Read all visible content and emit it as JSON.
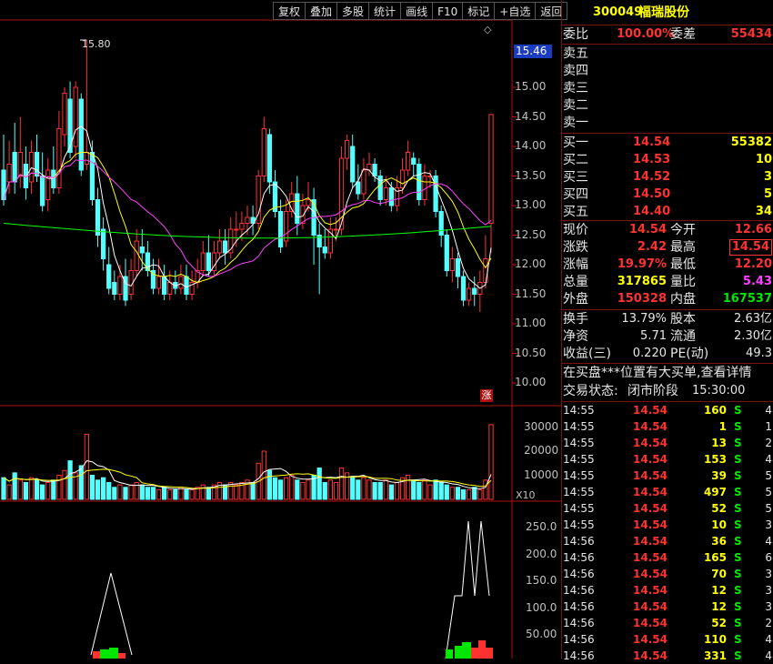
{
  "toolbar": [
    "复权",
    "叠加",
    "多股",
    "统计",
    "画线",
    "F10",
    "标记",
    "+自选",
    "返回"
  ],
  "chart": {
    "price_ticks": [
      "15.00",
      "14.50",
      "14.00",
      "13.50",
      "13.00",
      "12.50",
      "12.00",
      "11.50",
      "11.00",
      "10.50",
      "10.00"
    ],
    "current_price_label": "15.46",
    "high_marker_label": "15.80",
    "limit_up_badge": "涨",
    "diamond_icon": "◇",
    "volume_ticks": [
      "30000",
      "20000",
      "10000"
    ],
    "volume_unit": "X10",
    "indicator_ticks": [
      "250.0",
      "200.0",
      "150.0",
      "100.0",
      "50.00"
    ],
    "colors": {
      "up": "#ff3232",
      "down": "#54ffff",
      "ma5": "#ffffff",
      "ma10": "#ffff00",
      "ma20": "#ff40ff",
      "ma60": "#00ff00",
      "axis": "#b01010"
    }
  },
  "stock": {
    "code": "300049",
    "name": "福瑞股份"
  },
  "order_ratio": {
    "label_ratio": "委比",
    "ratio": "100.00%",
    "label_diff": "委差",
    "diff": "55434"
  },
  "asks": [
    {
      "label": "卖五",
      "price": "",
      "vol": ""
    },
    {
      "label": "卖四",
      "price": "",
      "vol": ""
    },
    {
      "label": "卖三",
      "price": "",
      "vol": ""
    },
    {
      "label": "卖二",
      "price": "",
      "vol": ""
    },
    {
      "label": "卖一",
      "price": "",
      "vol": ""
    }
  ],
  "bids": [
    {
      "label": "买一",
      "price": "14.54",
      "vol": "55382"
    },
    {
      "label": "买二",
      "price": "14.53",
      "vol": "10"
    },
    {
      "label": "买三",
      "price": "14.52",
      "vol": "3"
    },
    {
      "label": "买四",
      "price": "14.50",
      "vol": "5"
    },
    {
      "label": "买五",
      "price": "14.40",
      "vol": "34"
    }
  ],
  "stats": [
    {
      "l1": "现价",
      "v1": "14.54",
      "c1": "red",
      "l2": "今开",
      "v2": "12.66",
      "c2": "red"
    },
    {
      "l1": "涨跌",
      "v1": "2.42",
      "c1": "red",
      "l2": "最高",
      "v2": "14.54",
      "c2": "red"
    },
    {
      "l1": "涨幅",
      "v1": "19.97%",
      "c1": "red",
      "l2": "最低",
      "v2": "12.20",
      "c2": "red"
    },
    {
      "l1": "总量",
      "v1": "317865",
      "c1": "yel",
      "l2": "量比",
      "v2": "5.43",
      "c2": "mag"
    },
    {
      "l1": "外盘",
      "v1": "150328",
      "c1": "red",
      "l2": "内盘",
      "v2": "167537",
      "c2": "grn"
    }
  ],
  "fundamentals": [
    {
      "l1": "换手",
      "v1": "13.79%",
      "l2": "股本",
      "v2": "2.63亿"
    },
    {
      "l1": "净资",
      "v1": "5.71",
      "l2": "流通",
      "v2": "2.30亿"
    },
    {
      "l1": "收益(三)",
      "v1": "0.220",
      "l2": "PE(动)",
      "v2": "49.3"
    }
  ],
  "notice": "在买盘***位置有大买单,查看详情",
  "status": {
    "label": "交易状态:",
    "value": "闭市阶段",
    "time": "15:30:00"
  },
  "ticks": [
    {
      "time": "14:55",
      "price": "14.54",
      "vol": "160",
      "side": "S",
      "n": "4"
    },
    {
      "time": "14:55",
      "price": "14.54",
      "vol": "1",
      "side": "S",
      "n": "1"
    },
    {
      "time": "14:55",
      "price": "14.54",
      "vol": "13",
      "side": "S",
      "n": "2"
    },
    {
      "time": "14:55",
      "price": "14.54",
      "vol": "153",
      "side": "S",
      "n": "4"
    },
    {
      "time": "14:55",
      "price": "14.54",
      "vol": "39",
      "side": "S",
      "n": "5"
    },
    {
      "time": "14:55",
      "price": "14.54",
      "vol": "497",
      "side": "S",
      "n": "5"
    },
    {
      "time": "14:55",
      "price": "14.54",
      "vol": "52",
      "side": "S",
      "n": "5"
    },
    {
      "time": "14:55",
      "price": "14.54",
      "vol": "10",
      "side": "S",
      "n": "3"
    },
    {
      "time": "14:56",
      "price": "14.54",
      "vol": "36",
      "side": "S",
      "n": "4"
    },
    {
      "time": "14:56",
      "price": "14.54",
      "vol": "165",
      "side": "S",
      "n": "6"
    },
    {
      "time": "14:56",
      "price": "14.54",
      "vol": "70",
      "side": "S",
      "n": "3"
    },
    {
      "time": "14:56",
      "price": "14.54",
      "vol": "12",
      "side": "S",
      "n": "3"
    },
    {
      "time": "14:56",
      "price": "14.54",
      "vol": "12",
      "side": "S",
      "n": "3"
    },
    {
      "time": "14:56",
      "price": "14.54",
      "vol": "52",
      "side": "S",
      "n": "2"
    },
    {
      "time": "14:56",
      "price": "14.54",
      "vol": "110",
      "side": "S",
      "n": "4"
    },
    {
      "time": "14:56",
      "price": "14.54",
      "vol": "331",
      "side": "S",
      "n": "4"
    }
  ],
  "chart_data": {
    "type": "candlestick",
    "candles": [
      [
        13.6,
        13.1,
        14.2,
        13.0
      ],
      [
        13.4,
        13.7,
        14.1,
        13.2
      ],
      [
        13.9,
        13.4,
        14.4,
        13.2
      ],
      [
        13.5,
        13.9,
        14.5,
        13.3
      ],
      [
        13.7,
        13.3,
        14.0,
        13.1
      ],
      [
        13.4,
        13.9,
        14.1,
        13.2
      ],
      [
        13.9,
        13.5,
        14.2,
        13.4
      ],
      [
        13.5,
        13.0,
        13.9,
        12.9
      ],
      [
        13.1,
        13.6,
        13.8,
        12.9
      ],
      [
        13.6,
        13.3,
        14.0,
        13.2
      ],
      [
        13.3,
        14.3,
        14.6,
        13.2
      ],
      [
        14.2,
        14.9,
        15.0,
        14.0
      ],
      [
        14.8,
        13.9,
        15.1,
        13.8
      ],
      [
        14.0,
        15.0,
        15.1,
        13.8
      ],
      [
        14.8,
        13.6,
        14.9,
        13.5
      ],
      [
        13.7,
        13.9,
        15.8,
        13.6
      ],
      [
        13.9,
        13.1,
        14.1,
        13.0
      ],
      [
        13.1,
        12.5,
        13.3,
        12.3
      ],
      [
        12.6,
        12.1,
        12.8,
        11.9
      ],
      [
        12.0,
        11.6,
        12.3,
        11.5
      ],
      [
        11.7,
        11.5,
        11.9,
        11.4
      ],
      [
        11.5,
        11.8,
        12.0,
        11.4
      ],
      [
        11.8,
        11.4,
        12.1,
        11.3
      ],
      [
        11.5,
        11.9,
        12.1,
        11.4
      ],
      [
        11.9,
        12.4,
        12.6,
        11.8
      ],
      [
        12.3,
        12.2,
        12.6,
        11.9
      ],
      [
        12.2,
        11.9,
        12.4,
        11.8
      ],
      [
        11.9,
        11.6,
        12.1,
        11.5
      ],
      [
        11.6,
        11.8,
        12.1,
        11.5
      ],
      [
        11.8,
        11.5,
        12.0,
        11.4
      ],
      [
        11.5,
        11.7,
        11.9,
        11.4
      ],
      [
        11.7,
        11.6,
        11.9,
        11.5
      ],
      [
        11.6,
        11.8,
        12.0,
        11.5
      ],
      [
        11.8,
        11.5,
        12.0,
        11.4
      ],
      [
        11.5,
        11.7,
        11.9,
        11.4
      ],
      [
        11.7,
        11.9,
        12.1,
        11.6
      ],
      [
        11.9,
        12.2,
        12.4,
        11.8
      ],
      [
        12.2,
        11.9,
        12.5,
        11.8
      ],
      [
        11.9,
        12.2,
        12.4,
        11.8
      ],
      [
        12.2,
        12.4,
        12.6,
        12.1
      ],
      [
        12.4,
        12.2,
        12.6,
        12.0
      ],
      [
        12.2,
        12.6,
        12.8,
        12.1
      ],
      [
        12.6,
        12.6,
        12.9,
        12.3
      ],
      [
        12.6,
        12.7,
        12.9,
        12.4
      ],
      [
        12.7,
        12.8,
        13.0,
        12.5
      ],
      [
        12.8,
        12.7,
        13.0,
        12.5
      ],
      [
        12.7,
        13.5,
        13.6,
        12.6
      ],
      [
        13.5,
        14.3,
        14.5,
        13.4
      ],
      [
        14.2,
        13.4,
        14.3,
        13.2
      ],
      [
        13.4,
        12.9,
        13.6,
        12.8
      ],
      [
        12.9,
        12.3,
        13.1,
        12.2
      ],
      [
        12.4,
        12.9,
        13.1,
        12.3
      ],
      [
        12.9,
        13.2,
        13.4,
        12.8
      ],
      [
        13.2,
        12.7,
        13.5,
        12.5
      ],
      [
        12.7,
        13.0,
        13.2,
        12.6
      ],
      [
        13.0,
        13.1,
        13.4,
        12.9
      ],
      [
        13.1,
        12.5,
        13.3,
        12.0
      ],
      [
        12.5,
        12.3,
        12.7,
        11.5
      ],
      [
        12.3,
        12.2,
        12.6,
        12.1
      ],
      [
        12.2,
        12.6,
        12.8,
        12.1
      ],
      [
        12.6,
        12.6,
        12.8,
        12.4
      ],
      [
        12.6,
        13.8,
        14.0,
        12.5
      ],
      [
        13.8,
        14.1,
        14.2,
        13.6
      ],
      [
        14.0,
        13.4,
        14.2,
        13.3
      ],
      [
        13.4,
        13.2,
        13.7,
        13.1
      ],
      [
        13.2,
        13.6,
        13.8,
        13.1
      ],
      [
        13.6,
        13.7,
        13.9,
        13.5
      ],
      [
        13.7,
        13.5,
        13.8,
        13.4
      ],
      [
        13.5,
        13.1,
        13.6,
        13.0
      ],
      [
        13.1,
        13.3,
        13.5,
        13.0
      ],
      [
        13.3,
        13.0,
        13.4,
        12.9
      ],
      [
        13.0,
        13.3,
        13.5,
        12.9
      ],
      [
        13.3,
        13.6,
        13.8,
        13.2
      ],
      [
        13.6,
        13.9,
        14.1,
        13.5
      ],
      [
        13.8,
        13.7,
        13.9,
        13.5
      ],
      [
        13.7,
        13.1,
        13.8,
        13.0
      ],
      [
        13.1,
        13.5,
        13.7,
        13.0
      ],
      [
        13.5,
        13.5,
        13.6,
        13.3
      ],
      [
        13.5,
        12.9,
        13.6,
        12.8
      ],
      [
        12.9,
        12.5,
        13.0,
        12.3
      ],
      [
        12.5,
        11.9,
        12.6,
        11.8
      ],
      [
        11.9,
        12.1,
        12.3,
        11.7
      ],
      [
        12.1,
        11.8,
        12.2,
        11.6
      ],
      [
        11.8,
        11.4,
        11.9,
        11.3
      ],
      [
        11.4,
        11.6,
        11.7,
        11.3
      ],
      [
        11.6,
        11.5,
        11.8,
        11.3
      ],
      [
        11.5,
        11.7,
        11.9,
        11.2
      ],
      [
        11.7,
        12.1,
        12.5,
        11.6
      ],
      [
        12.7,
        14.54,
        14.54,
        12.2
      ]
    ],
    "volume": [
      9,
      6,
      11,
      8,
      7,
      9,
      8,
      6,
      7,
      8,
      10,
      12,
      16,
      11,
      14,
      27,
      10,
      8,
      9,
      7,
      5,
      6,
      5,
      6,
      7,
      6,
      5,
      5,
      4,
      5,
      4,
      4,
      5,
      4,
      4,
      5,
      6,
      5,
      6,
      7,
      6,
      7,
      6,
      7,
      8,
      7,
      15,
      20,
      12,
      9,
      8,
      9,
      10,
      8,
      7,
      8,
      10,
      13,
      7,
      8,
      7,
      13,
      11,
      9,
      8,
      9,
      8,
      7,
      7,
      8,
      6,
      7,
      9,
      10,
      8,
      7,
      8,
      6,
      8,
      7,
      6,
      5,
      5,
      4,
      4,
      5,
      4,
      8,
      31
    ],
    "ylim": [
      10.0,
      15.9
    ]
  }
}
